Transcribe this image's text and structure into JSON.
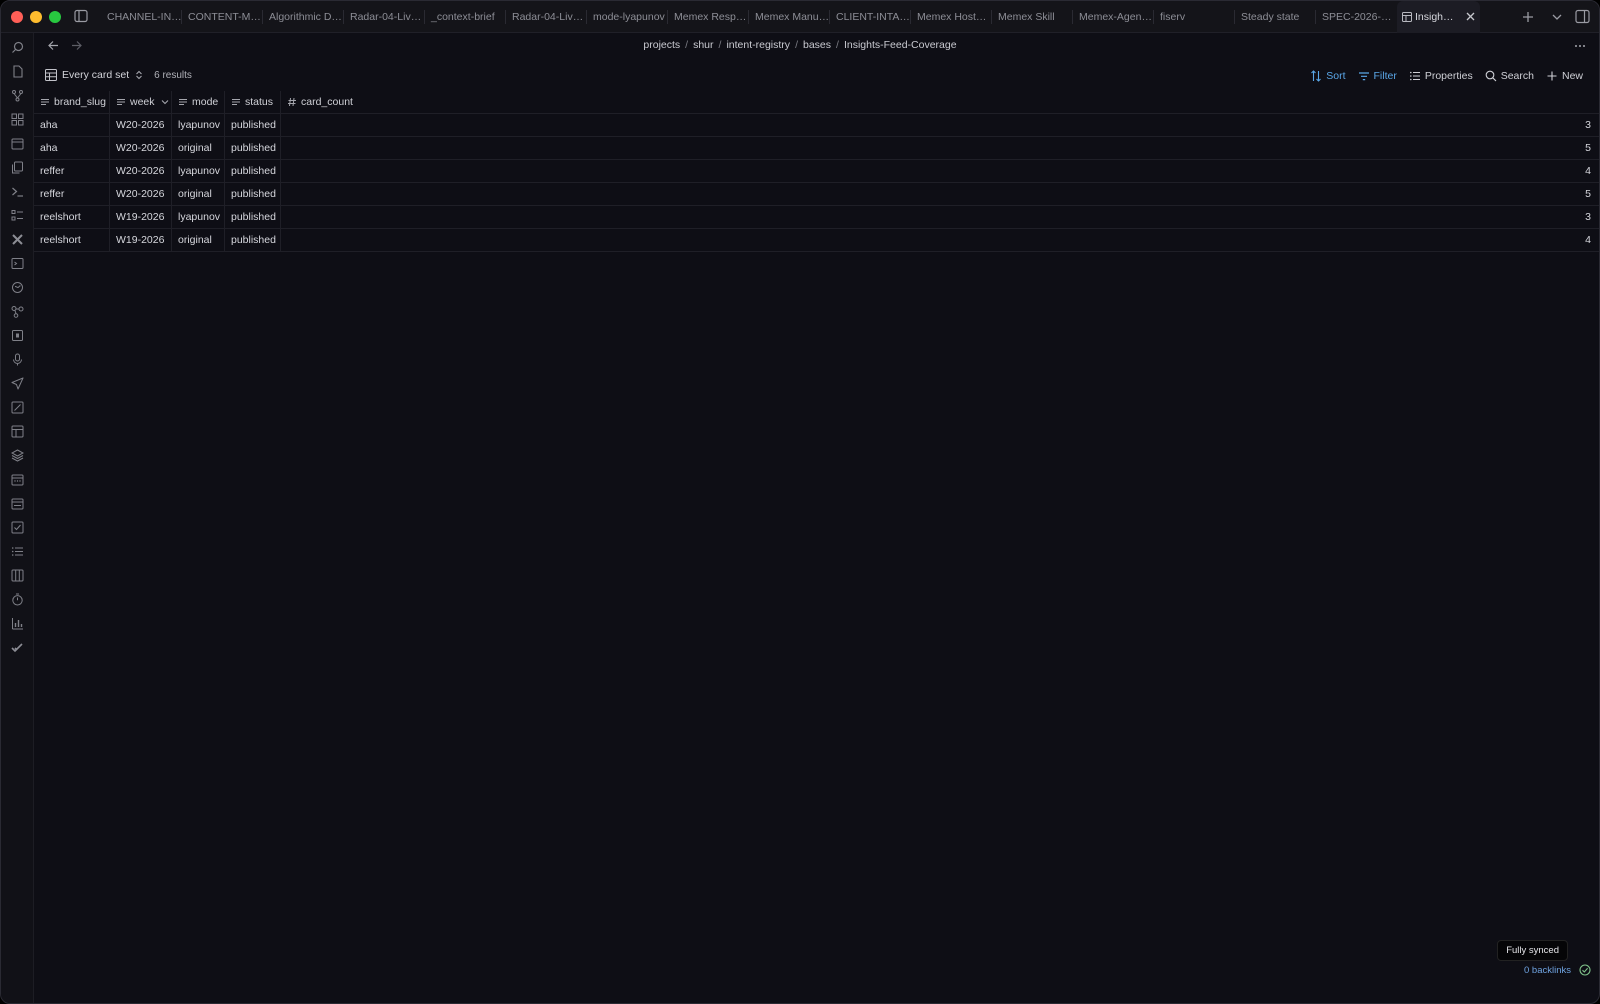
{
  "tabs": [
    "CHANNEL-IN…",
    "CONTENT-M…",
    "Algorithmic D…",
    "Radar-04-Liv…",
    "_context-brief",
    "Radar-04-Liv…",
    "mode-lyapunov",
    "Memex Resp…",
    "Memex Manu…",
    "CLIENT-INTA…",
    "Memex Host…",
    "Memex Skill",
    "Memex-Agen…",
    "fiserv",
    "Steady state",
    "SPEC-2026-…"
  ],
  "active_tab": "Insigh…",
  "breadcrumb": [
    "projects",
    "shur",
    "intent-registry",
    "bases",
    "Insights-Feed-Coverage"
  ],
  "breadcrumb_sep": "/",
  "view": {
    "name": "Every card set",
    "results": "6 results"
  },
  "toolbar": {
    "sort": "Sort",
    "filter": "Filter",
    "properties": "Properties",
    "search": "Search",
    "new": "New"
  },
  "table": {
    "columns": [
      "brand_slug",
      "week",
      "mode",
      "status",
      "card_count"
    ],
    "rows": [
      [
        "aha",
        "W20-2026",
        "lyapunov",
        "published",
        "3"
      ],
      [
        "aha",
        "W20-2026",
        "original",
        "published",
        "5"
      ],
      [
        "reffer",
        "W20-2026",
        "lyapunov",
        "published",
        "4"
      ],
      [
        "reffer",
        "W20-2026",
        "original",
        "published",
        "5"
      ],
      [
        "reelshort",
        "W19-2026",
        "lyapunov",
        "published",
        "3"
      ],
      [
        "reelshort",
        "W19-2026",
        "original",
        "published",
        "4"
      ]
    ]
  },
  "status": {
    "tooltip": "Fully synced",
    "backlinks": "0 backlinks"
  },
  "colors": {
    "accent": "#5aa7e8",
    "background": "#0e0e15"
  }
}
